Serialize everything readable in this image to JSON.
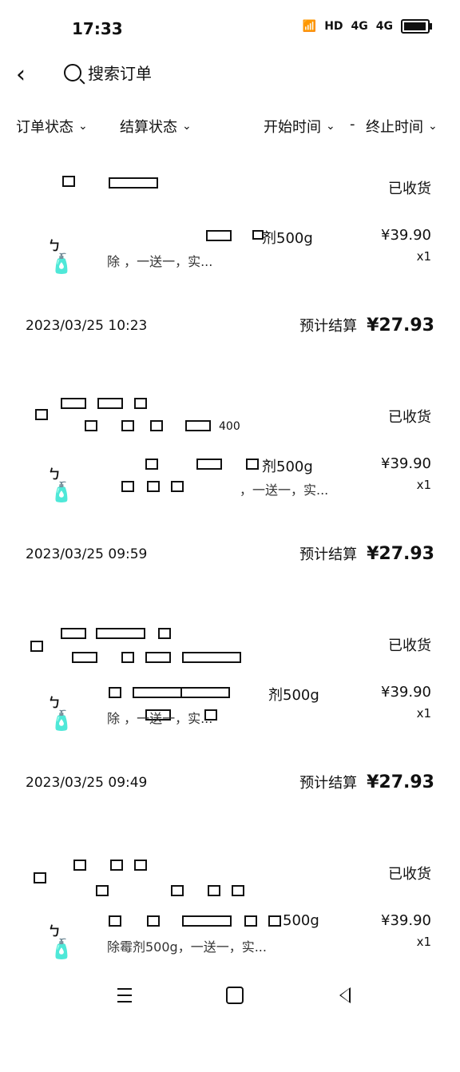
{
  "status_bar": {
    "time": "17:33",
    "network_left": "4G",
    "network_right": "4G",
    "hd": "HD"
  },
  "header": {
    "search_placeholder": "搜索订单"
  },
  "filters": [
    {
      "label": "订单状态"
    },
    {
      "label": "结算状态"
    },
    {
      "label": "开始时间"
    },
    {
      "separator": "-"
    },
    {
      "label": "终止时间"
    }
  ],
  "orders": [
    {
      "status": "已收货",
      "title": "剂500g",
      "subtitle": "除       ，一送一，实...",
      "price": "¥39.90",
      "qty": "x1",
      "date": "2023/03/25 10:23",
      "settle_label": "预计结算",
      "settle_value": "¥27.93"
    },
    {
      "status": "已收货",
      "extra": "400",
      "title": "剂500g",
      "subtitle": "，一送一，实...",
      "price": "¥39.90",
      "qty": "x1",
      "date": "2023/03/25 09:59",
      "settle_label": "预计结算",
      "settle_value": "¥27.93"
    },
    {
      "status": "已收货",
      "title": "剂500g",
      "subtitle": "除       ，一送一，实...",
      "price": "¥39.90",
      "qty": "x1",
      "date": "2023/03/25 09:49",
      "settle_label": "预计结算",
      "settle_value": "¥27.93"
    },
    {
      "status": "已收货",
      "title": "500g",
      "subtitle": "除霉剂500g，一送一，实...",
      "price": "¥39.90",
      "qty": "x1"
    }
  ],
  "navbar": {
    "menu": "menu",
    "home": "home",
    "back": "back"
  }
}
